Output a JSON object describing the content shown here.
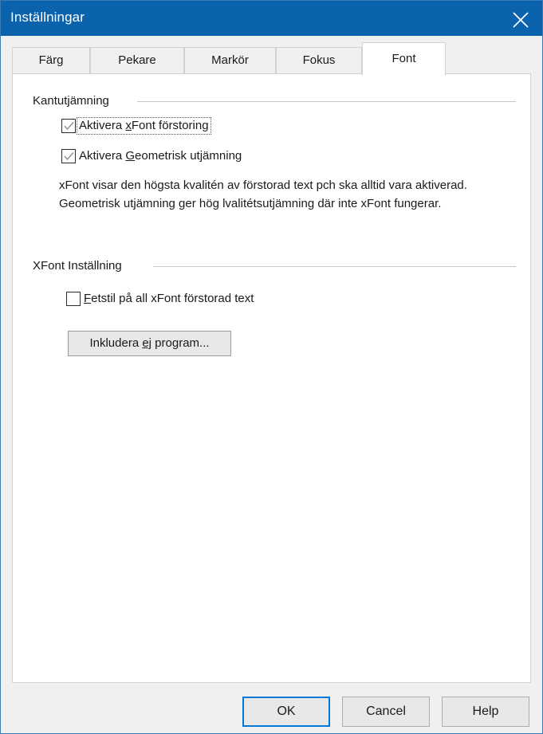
{
  "window": {
    "title": "Inställningar",
    "close_icon": "close-icon",
    "titlebar_color": "#0b62ad",
    "border_color": "#3a7cb8",
    "accent_color": "#0078d7"
  },
  "tabs": [
    {
      "label": "Färg",
      "selected": false
    },
    {
      "label": "Pekare",
      "selected": false
    },
    {
      "label": "Markör",
      "selected": false
    },
    {
      "label": "Fokus",
      "selected": false
    },
    {
      "label": "Font",
      "selected": true
    }
  ],
  "groups": [
    {
      "title": "Kantutjämning",
      "checkboxes": [
        {
          "label_before": "Aktivera ",
          "accelerator": "x",
          "label_after": "Font förstoring",
          "checked": true,
          "focused": true
        },
        {
          "label_before": "Aktivera ",
          "accelerator": "G",
          "label_after": "eometrisk utjämning",
          "checked": true,
          "focused": false
        }
      ],
      "description": "xFont visar den högsta kvalitén av förstorad text pch ska alltid vara aktiverad. Geometrisk utjämning ger hög lvalitétsutjämning där inte xFont fungerar."
    },
    {
      "title": "XFont Inställning",
      "checkboxes": [
        {
          "label_before": "",
          "accelerator": "F",
          "label_after": "etstil på all xFont förstorad text",
          "checked": false,
          "focused": false
        }
      ],
      "button": {
        "label_before": "Inkludera ",
        "accelerator": "ej",
        "label_after": " program..."
      }
    }
  ],
  "footer": {
    "ok_label": "OK",
    "cancel_label": "Cancel",
    "help_label": "Help"
  }
}
